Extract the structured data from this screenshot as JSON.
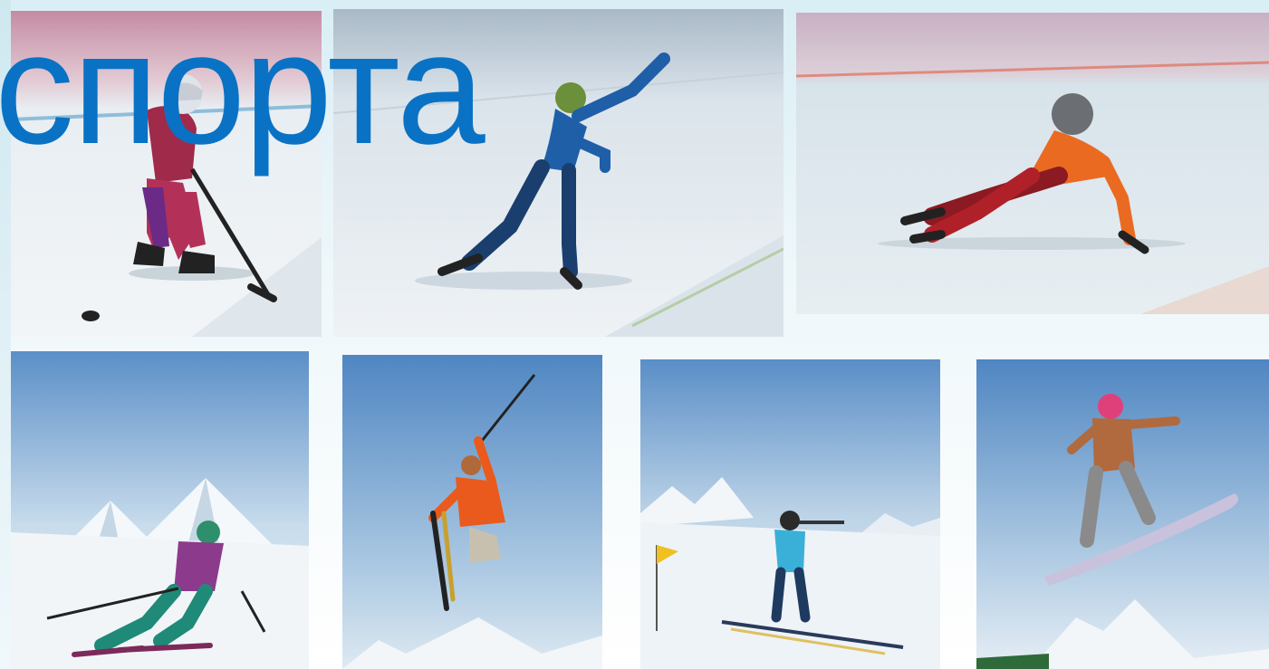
{
  "slide": {
    "title_fragment": "спорта"
  },
  "panels": [
    {
      "icon": "ice-hockey-icon"
    },
    {
      "icon": "speed-skating-icon"
    },
    {
      "icon": "short-track-icon"
    },
    {
      "icon": "alpine-skiing-icon"
    },
    {
      "icon": "freestyle-skiing-icon"
    },
    {
      "icon": "biathlon-icon"
    },
    {
      "icon": "snowboard-icon"
    }
  ],
  "colors": {
    "title": "#0a72c4",
    "sky_top": "#5b8fc7",
    "sky_bottom": "#cfe0ef",
    "ice": "#e6eef3"
  }
}
